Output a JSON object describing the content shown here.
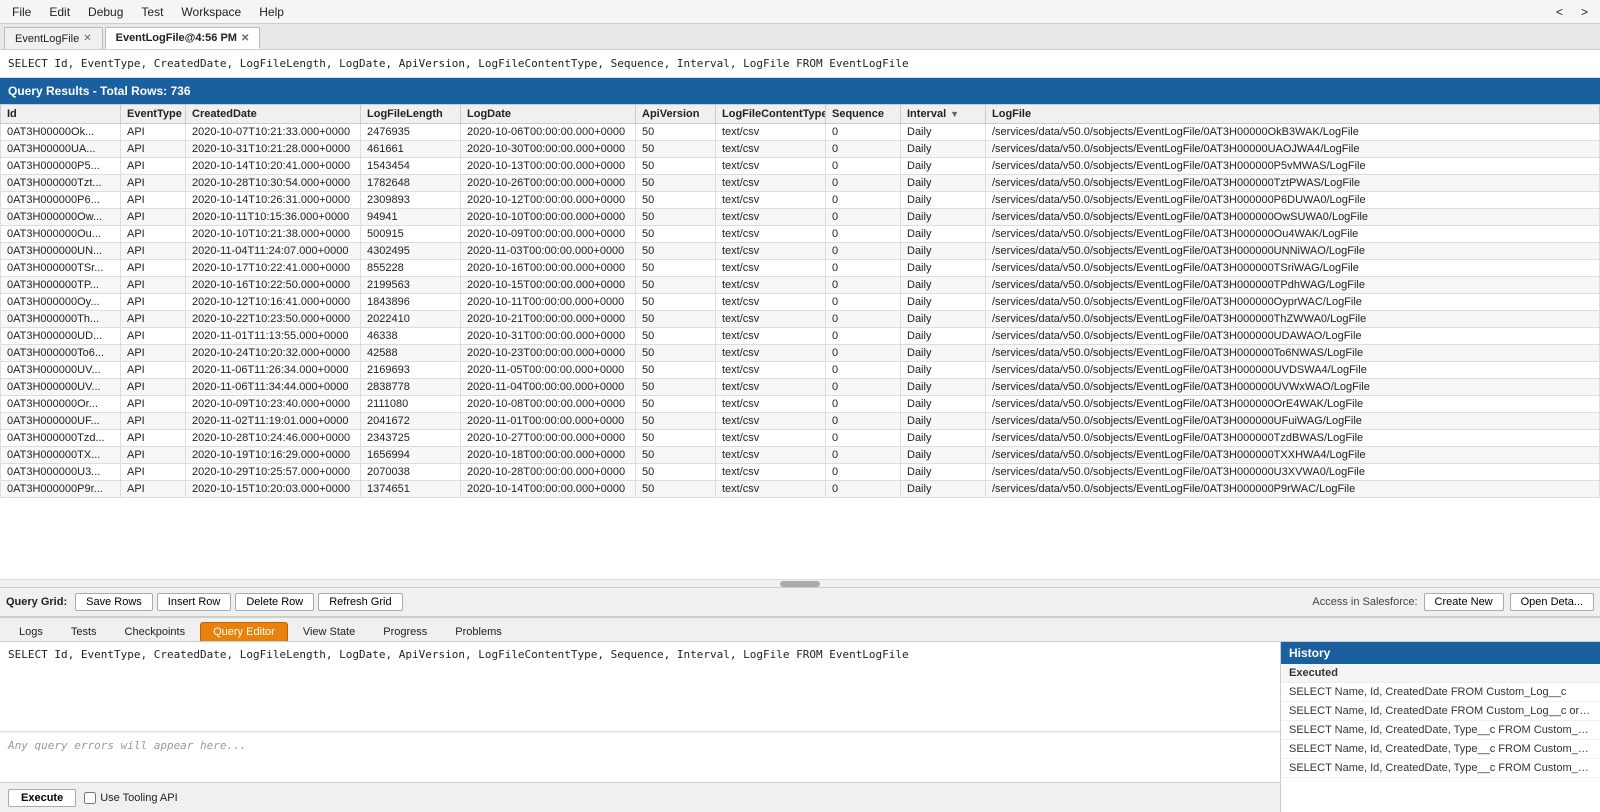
{
  "menu": {
    "items": [
      {
        "label": "File",
        "id": "file"
      },
      {
        "label": "Edit",
        "id": "edit"
      },
      {
        "label": "Debug",
        "id": "debug"
      },
      {
        "label": "Test",
        "id": "test"
      },
      {
        "label": "Workspace",
        "id": "workspace"
      },
      {
        "label": "Help",
        "id": "help"
      },
      {
        "label": "<",
        "id": "prev"
      },
      {
        "label": ">",
        "id": "next"
      }
    ]
  },
  "tabs": [
    {
      "label": "EventLogFile",
      "id": "tab1",
      "active": false,
      "closable": true
    },
    {
      "label": "EventLogFile@4:56 PM",
      "id": "tab2",
      "active": true,
      "closable": true
    }
  ],
  "sql_bar": {
    "text": "SELECT Id, EventType, CreatedDate, LogFileLength, LogDate, ApiVersion, LogFileContentType, Sequence, Interval, LogFile FROM EventLogFile"
  },
  "results": {
    "header": "Query Results - Total Rows: 736",
    "columns": [
      {
        "key": "id",
        "label": "Id",
        "class": "col-id"
      },
      {
        "key": "eventtype",
        "label": "EventType",
        "class": "col-eventtype"
      },
      {
        "key": "createddate",
        "label": "CreatedDate",
        "class": "col-createddate"
      },
      {
        "key": "logfilelength",
        "label": "LogFileLength",
        "class": "col-logfilelength"
      },
      {
        "key": "logdate",
        "label": "LogDate",
        "class": "col-logdate"
      },
      {
        "key": "apiversion",
        "label": "ApiVersion",
        "class": "col-apiversion"
      },
      {
        "key": "logfilecontenttype",
        "label": "LogFileContentType",
        "class": "col-logfilecontenttype"
      },
      {
        "key": "sequence",
        "label": "Sequence",
        "class": "col-sequence"
      },
      {
        "key": "interval",
        "label": "Interval",
        "class": "col-interval",
        "sorted": true,
        "sortDir": "desc"
      },
      {
        "key": "logfile",
        "label": "LogFile",
        "class": "col-logfile"
      }
    ],
    "rows": [
      {
        "id": "0AT3H00000Ok...",
        "eventtype": "API",
        "createddate": "2020-10-07T10:21:33.000+0000",
        "logfilelength": "2476935",
        "logdate": "2020-10-06T00:00:00.000+0000",
        "apiversion": "50",
        "logfilecontenttype": "text/csv",
        "sequence": "0",
        "interval": "Daily",
        "logfile": "/services/data/v50.0/sobjects/EventLogFile/0AT3H00000OkB3WAK/LogFile"
      },
      {
        "id": "0AT3H00000UA...",
        "eventtype": "API",
        "createddate": "2020-10-31T10:21:28.000+0000",
        "logfilelength": "461661",
        "logdate": "2020-10-30T00:00:00.000+0000",
        "apiversion": "50",
        "logfilecontenttype": "text/csv",
        "sequence": "0",
        "interval": "Daily",
        "logfile": "/services/data/v50.0/sobjects/EventLogFile/0AT3H00000UAOJWA4/LogFile"
      },
      {
        "id": "0AT3H000000P5...",
        "eventtype": "API",
        "createddate": "2020-10-14T10:20:41.000+0000",
        "logfilelength": "1543454",
        "logdate": "2020-10-13T00:00:00.000+0000",
        "apiversion": "50",
        "logfilecontenttype": "text/csv",
        "sequence": "0",
        "interval": "Daily",
        "logfile": "/services/data/v50.0/sobjects/EventLogFile/0AT3H000000P5vMWAS/LogFile"
      },
      {
        "id": "0AT3H000000Tzt...",
        "eventtype": "API",
        "createddate": "2020-10-28T10:30:54.000+0000",
        "logfilelength": "1782648",
        "logdate": "2020-10-26T00:00:00.000+0000",
        "apiversion": "50",
        "logfilecontenttype": "text/csv",
        "sequence": "0",
        "interval": "Daily",
        "logfile": "/services/data/v50.0/sobjects/EventLogFile/0AT3H000000TztPWAS/LogFile"
      },
      {
        "id": "0AT3H000000P6...",
        "eventtype": "API",
        "createddate": "2020-10-14T10:26:31.000+0000",
        "logfilelength": "2309893",
        "logdate": "2020-10-12T00:00:00.000+0000",
        "apiversion": "50",
        "logfilecontenttype": "text/csv",
        "sequence": "0",
        "interval": "Daily",
        "logfile": "/services/data/v50.0/sobjects/EventLogFile/0AT3H000000P6DUWA0/LogFile"
      },
      {
        "id": "0AT3H000000Ow...",
        "eventtype": "API",
        "createddate": "2020-10-11T10:15:36.000+0000",
        "logfilelength": "94941",
        "logdate": "2020-10-10T00:00:00.000+0000",
        "apiversion": "50",
        "logfilecontenttype": "text/csv",
        "sequence": "0",
        "interval": "Daily",
        "logfile": "/services/data/v50.0/sobjects/EventLogFile/0AT3H000000OwSUWA0/LogFile"
      },
      {
        "id": "0AT3H000000Ou...",
        "eventtype": "API",
        "createddate": "2020-10-10T10:21:38.000+0000",
        "logfilelength": "500915",
        "logdate": "2020-10-09T00:00:00.000+0000",
        "apiversion": "50",
        "logfilecontenttype": "text/csv",
        "sequence": "0",
        "interval": "Daily",
        "logfile": "/services/data/v50.0/sobjects/EventLogFile/0AT3H000000Ou4WAK/LogFile"
      },
      {
        "id": "0AT3H000000UN...",
        "eventtype": "API",
        "createddate": "2020-11-04T11:24:07.000+0000",
        "logfilelength": "4302495",
        "logdate": "2020-11-03T00:00:00.000+0000",
        "apiversion": "50",
        "logfilecontenttype": "text/csv",
        "sequence": "0",
        "interval": "Daily",
        "logfile": "/services/data/v50.0/sobjects/EventLogFile/0AT3H000000UNNiWAO/LogFile"
      },
      {
        "id": "0AT3H000000TSr...",
        "eventtype": "API",
        "createddate": "2020-10-17T10:22:41.000+0000",
        "logfilelength": "855228",
        "logdate": "2020-10-16T00:00:00.000+0000",
        "apiversion": "50",
        "logfilecontenttype": "text/csv",
        "sequence": "0",
        "interval": "Daily",
        "logfile": "/services/data/v50.0/sobjects/EventLogFile/0AT3H000000TSriWAG/LogFile"
      },
      {
        "id": "0AT3H000000TP...",
        "eventtype": "API",
        "createddate": "2020-10-16T10:22:50.000+0000",
        "logfilelength": "2199563",
        "logdate": "2020-10-15T00:00:00.000+0000",
        "apiversion": "50",
        "logfilecontenttype": "text/csv",
        "sequence": "0",
        "interval": "Daily",
        "logfile": "/services/data/v50.0/sobjects/EventLogFile/0AT3H000000TPdhWAG/LogFile"
      },
      {
        "id": "0AT3H000000Oy...",
        "eventtype": "API",
        "createddate": "2020-10-12T10:16:41.000+0000",
        "logfilelength": "1843896",
        "logdate": "2020-10-11T00:00:00.000+0000",
        "apiversion": "50",
        "logfilecontenttype": "text/csv",
        "sequence": "0",
        "interval": "Daily",
        "logfile": "/services/data/v50.0/sobjects/EventLogFile/0AT3H000000OyprWAC/LogFile"
      },
      {
        "id": "0AT3H000000Th...",
        "eventtype": "API",
        "createddate": "2020-10-22T10:23:50.000+0000",
        "logfilelength": "2022410",
        "logdate": "2020-10-21T00:00:00.000+0000",
        "apiversion": "50",
        "logfilecontenttype": "text/csv",
        "sequence": "0",
        "interval": "Daily",
        "logfile": "/services/data/v50.0/sobjects/EventLogFile/0AT3H000000ThZWWA0/LogFile"
      },
      {
        "id": "0AT3H000000UD...",
        "eventtype": "API",
        "createddate": "2020-11-01T11:13:55.000+0000",
        "logfilelength": "46338",
        "logdate": "2020-10-31T00:00:00.000+0000",
        "apiversion": "50",
        "logfilecontenttype": "text/csv",
        "sequence": "0",
        "interval": "Daily",
        "logfile": "/services/data/v50.0/sobjects/EventLogFile/0AT3H000000UDAWAO/LogFile"
      },
      {
        "id": "0AT3H000000To6...",
        "eventtype": "API",
        "createddate": "2020-10-24T10:20:32.000+0000",
        "logfilelength": "42588",
        "logdate": "2020-10-23T00:00:00.000+0000",
        "apiversion": "50",
        "logfilecontenttype": "text/csv",
        "sequence": "0",
        "interval": "Daily",
        "logfile": "/services/data/v50.0/sobjects/EventLogFile/0AT3H000000To6NWAS/LogFile"
      },
      {
        "id": "0AT3H000000UV...",
        "eventtype": "API",
        "createddate": "2020-11-06T11:26:34.000+0000",
        "logfilelength": "2169693",
        "logdate": "2020-11-05T00:00:00.000+0000",
        "apiversion": "50",
        "logfilecontenttype": "text/csv",
        "sequence": "0",
        "interval": "Daily",
        "logfile": "/services/data/v50.0/sobjects/EventLogFile/0AT3H000000UVDSWA4/LogFile"
      },
      {
        "id": "0AT3H000000UV...",
        "eventtype": "API",
        "createddate": "2020-11-06T11:34:44.000+0000",
        "logfilelength": "2838778",
        "logdate": "2020-11-04T00:00:00.000+0000",
        "apiversion": "50",
        "logfilecontenttype": "text/csv",
        "sequence": "0",
        "interval": "Daily",
        "logfile": "/services/data/v50.0/sobjects/EventLogFile/0AT3H000000UVWxWAO/LogFile"
      },
      {
        "id": "0AT3H000000Or...",
        "eventtype": "API",
        "createddate": "2020-10-09T10:23:40.000+0000",
        "logfilelength": "2111080",
        "logdate": "2020-10-08T00:00:00.000+0000",
        "apiversion": "50",
        "logfilecontenttype": "text/csv",
        "sequence": "0",
        "interval": "Daily",
        "logfile": "/services/data/v50.0/sobjects/EventLogFile/0AT3H000000OrE4WAK/LogFile"
      },
      {
        "id": "0AT3H000000UF...",
        "eventtype": "API",
        "createddate": "2020-11-02T11:19:01.000+0000",
        "logfilelength": "2041672",
        "logdate": "2020-11-01T00:00:00.000+0000",
        "apiversion": "50",
        "logfilecontenttype": "text/csv",
        "sequence": "0",
        "interval": "Daily",
        "logfile": "/services/data/v50.0/sobjects/EventLogFile/0AT3H000000UFuiWAG/LogFile"
      },
      {
        "id": "0AT3H000000Tzd...",
        "eventtype": "API",
        "createddate": "2020-10-28T10:24:46.000+0000",
        "logfilelength": "2343725",
        "logdate": "2020-10-27T00:00:00.000+0000",
        "apiversion": "50",
        "logfilecontenttype": "text/csv",
        "sequence": "0",
        "interval": "Daily",
        "logfile": "/services/data/v50.0/sobjects/EventLogFile/0AT3H000000TzdBWAS/LogFile"
      },
      {
        "id": "0AT3H000000TX...",
        "eventtype": "API",
        "createddate": "2020-10-19T10:16:29.000+0000",
        "logfilelength": "1656994",
        "logdate": "2020-10-18T00:00:00.000+0000",
        "apiversion": "50",
        "logfilecontenttype": "text/csv",
        "sequence": "0",
        "interval": "Daily",
        "logfile": "/services/data/v50.0/sobjects/EventLogFile/0AT3H000000TXXHWA4/LogFile"
      },
      {
        "id": "0AT3H000000U3...",
        "eventtype": "API",
        "createddate": "2020-10-29T10:25:57.000+0000",
        "logfilelength": "2070038",
        "logdate": "2020-10-28T00:00:00.000+0000",
        "apiversion": "50",
        "logfilecontenttype": "text/csv",
        "sequence": "0",
        "interval": "Daily",
        "logfile": "/services/data/v50.0/sobjects/EventLogFile/0AT3H000000U3XVWA0/LogFile"
      },
      {
        "id": "0AT3H000000P9r...",
        "eventtype": "API",
        "createddate": "2020-10-15T10:20:03.000+0000",
        "logfilelength": "1374651",
        "logdate": "2020-10-14T00:00:00.000+0000",
        "apiversion": "50",
        "logfilecontenttype": "text/csv",
        "sequence": "0",
        "interval": "Daily",
        "logfile": "/services/data/v50.0/sobjects/EventLogFile/0AT3H000000P9rWAC/LogFile"
      }
    ]
  },
  "grid_toolbar": {
    "label": "Query Grid:",
    "save_rows": "Save Rows",
    "insert_row": "Insert Row",
    "delete_row": "Delete Row",
    "refresh_grid": "Refresh Grid",
    "access_label": "Access in Salesforce:",
    "create_new": "Create New",
    "open_detail": "Open Deta..."
  },
  "bottom_tabs": [
    {
      "label": "Logs",
      "id": "logs",
      "active": false
    },
    {
      "label": "Tests",
      "id": "tests",
      "active": false
    },
    {
      "label": "Checkpoints",
      "id": "checkpoints",
      "active": false
    },
    {
      "label": "Query Editor",
      "id": "query-editor",
      "active": true
    },
    {
      "label": "View State",
      "id": "view-state",
      "active": false
    },
    {
      "label": "Progress",
      "id": "progress",
      "active": false
    },
    {
      "label": "Problems",
      "id": "problems",
      "active": false
    }
  ],
  "query_editor": {
    "text": "SELECT Id, EventType, CreatedDate, LogFileLength, LogDate, ApiVersion, LogFileContentType, Sequence, Interval, LogFile FROM EventLogFile",
    "error_placeholder": "Any query errors will appear here...",
    "execute_label": "Execute",
    "tooling_api_label": "Use Tooling API"
  },
  "history": {
    "header": "History",
    "section_label": "Executed",
    "items": [
      "SELECT Name, Id, CreatedDate FROM Custom_Log__c",
      "SELECT Name, Id, CreatedDate FROM Custom_Log__c order by C",
      "SELECT Name, Id, CreatedDate, Type__c FROM Custom_Log__c o",
      "SELECT Name, Id, CreatedDate, Type__c FROM Custom_Log__c w",
      "SELECT Name, Id, CreatedDate, Type__c FROM Custom_Log__c w"
    ]
  }
}
